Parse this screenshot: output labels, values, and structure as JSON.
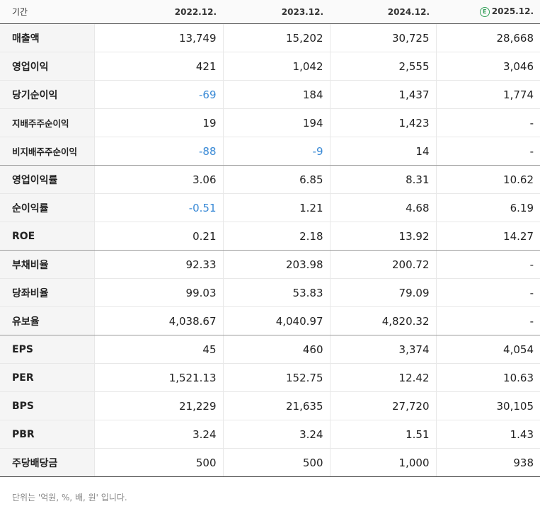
{
  "header": {
    "period_label": "기간",
    "periods": [
      "2022.12.",
      "2023.12.",
      "2024.12.",
      "2025.12."
    ],
    "estimate_badge": "E"
  },
  "rows": [
    {
      "label": "매출액",
      "values": [
        "13,749",
        "15,202",
        "30,725",
        "28,668"
      ]
    },
    {
      "label": "영업이익",
      "values": [
        "421",
        "1,042",
        "2,555",
        "3,046"
      ]
    },
    {
      "label": "당기순이익",
      "values": [
        "-69",
        "184",
        "1,437",
        "1,774"
      ]
    },
    {
      "label": "지배주주순이익",
      "values": [
        "19",
        "194",
        "1,423",
        "-"
      ]
    },
    {
      "label": "비지배주주순이익",
      "values": [
        "-88",
        "-9",
        "14",
        "-"
      ]
    },
    {
      "label": "영업이익률",
      "values": [
        "3.06",
        "6.85",
        "8.31",
        "10.62"
      ]
    },
    {
      "label": "순이익률",
      "values": [
        "-0.51",
        "1.21",
        "4.68",
        "6.19"
      ]
    },
    {
      "label": "ROE",
      "values": [
        "0.21",
        "2.18",
        "13.92",
        "14.27"
      ]
    },
    {
      "label": "부채비율",
      "values": [
        "92.33",
        "203.98",
        "200.72",
        "-"
      ]
    },
    {
      "label": "당좌비율",
      "values": [
        "99.03",
        "53.83",
        "79.09",
        "-"
      ]
    },
    {
      "label": "유보율",
      "values": [
        "4,038.67",
        "4,040.97",
        "4,820.32",
        "-"
      ]
    },
    {
      "label": "EPS",
      "values": [
        "45",
        "460",
        "3,374",
        "4,054"
      ]
    },
    {
      "label": "PER",
      "values": [
        "1,521.13",
        "152.75",
        "12.42",
        "10.63"
      ]
    },
    {
      "label": "BPS",
      "values": [
        "21,229",
        "21,635",
        "27,720",
        "30,105"
      ]
    },
    {
      "label": "PBR",
      "values": [
        "3.24",
        "3.24",
        "1.51",
        "1.43"
      ]
    },
    {
      "label": "주당배당금",
      "values": [
        "500",
        "500",
        "1,000",
        "938"
      ]
    }
  ],
  "colors": {
    "negative": "#3a8ad6",
    "estimate": "#35a05a"
  },
  "footnote": "단위는 '억원, %, 배, 원' 입니다."
}
